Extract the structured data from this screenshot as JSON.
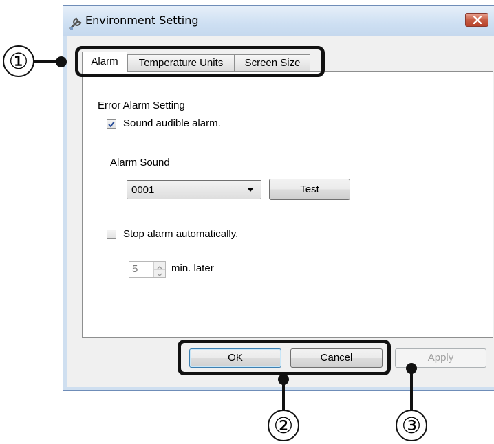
{
  "window": {
    "title": "Environment Setting",
    "icon": "wrench-icon",
    "close_icon": "close-icon"
  },
  "tabs": [
    {
      "label": "Alarm",
      "active": true
    },
    {
      "label": "Temperature Units",
      "active": false
    },
    {
      "label": "Screen Size",
      "active": false
    }
  ],
  "alarm_tab": {
    "group_label": "Error Alarm Setting",
    "sound_checkbox": {
      "label": "Sound audible alarm.",
      "checked": true
    },
    "alarm_sound_label": "Alarm Sound",
    "alarm_sound_value": "0001",
    "test_button": "Test",
    "stop_checkbox": {
      "label": "Stop alarm automatically.",
      "checked": false
    },
    "minutes_value": "5",
    "minutes_suffix": "min. later"
  },
  "buttons": {
    "ok": "OK",
    "cancel": "Cancel",
    "apply": "Apply"
  },
  "callouts": [
    "①",
    "②",
    "③"
  ],
  "colors": {
    "title_gradient_top": "#e6eff9",
    "close_button": "#c65b43",
    "annotation": "#111111"
  }
}
